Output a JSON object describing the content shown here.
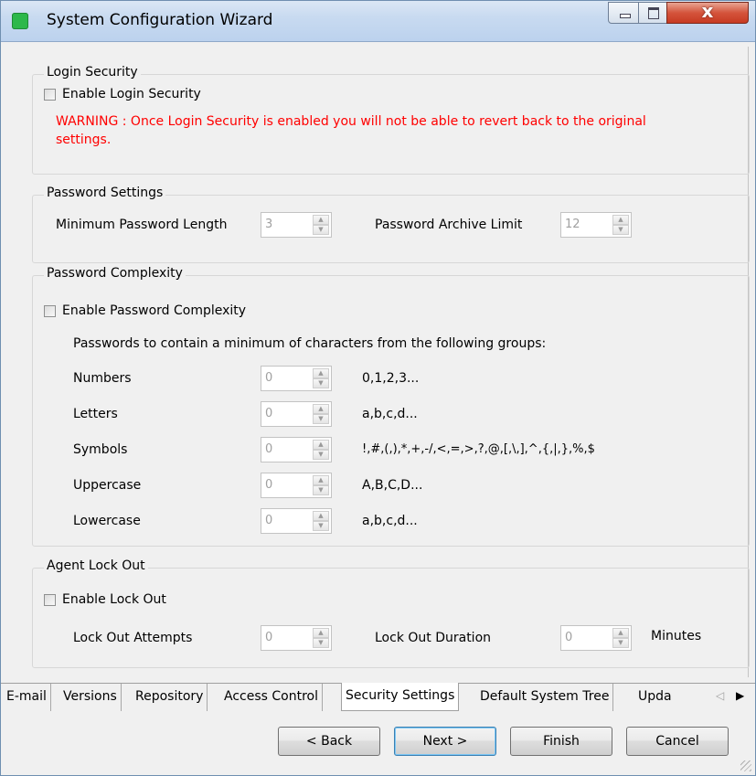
{
  "window": {
    "title": "System Configuration Wizard",
    "close_glyph": "x"
  },
  "login_security": {
    "title": "Login Security",
    "enable_label": "Enable Login Security",
    "warning": "WARNING : Once Login Security is enabled you will not be able to revert back to the original settings."
  },
  "password_settings": {
    "title": "Password Settings",
    "min_length_label": "Minimum Password Length",
    "min_length_value": "3",
    "archive_limit_label": "Password Archive Limit",
    "archive_limit_value": "12"
  },
  "password_complexity": {
    "title": "Password Complexity",
    "enable_label": "Enable Password Complexity",
    "description": "Passwords to contain a minimum of characters from the following groups:",
    "groups": [
      {
        "label": "Numbers",
        "value": "0",
        "example": "0,1,2,3..."
      },
      {
        "label": "Letters",
        "value": "0",
        "example": "a,b,c,d..."
      },
      {
        "label": "Symbols",
        "value": "0",
        "example": "!,#,(,),*,+,-/,<,=,>,?,@,[,\\,],^,{,|,},%,$"
      },
      {
        "label": "Uppercase",
        "value": "0",
        "example": "A,B,C,D..."
      },
      {
        "label": "Lowercase",
        "value": "0",
        "example": "a,b,c,d..."
      }
    ]
  },
  "agent_lockout": {
    "title": "Agent Lock Out",
    "enable_label": "Enable Lock Out",
    "attempts_label": "Lock Out Attempts",
    "attempts_value": "0",
    "duration_label": "Lock Out Duration",
    "duration_value": "0",
    "duration_unit": "Minutes"
  },
  "tabs": [
    "E-mail",
    "Versions",
    "Repository",
    "Access Control",
    "Security Settings",
    "Default System Tree",
    "Upda"
  ],
  "active_tab": "Security Settings",
  "buttons": {
    "back": "< Back",
    "next": "Next >",
    "finish": "Finish",
    "cancel": "Cancel"
  }
}
